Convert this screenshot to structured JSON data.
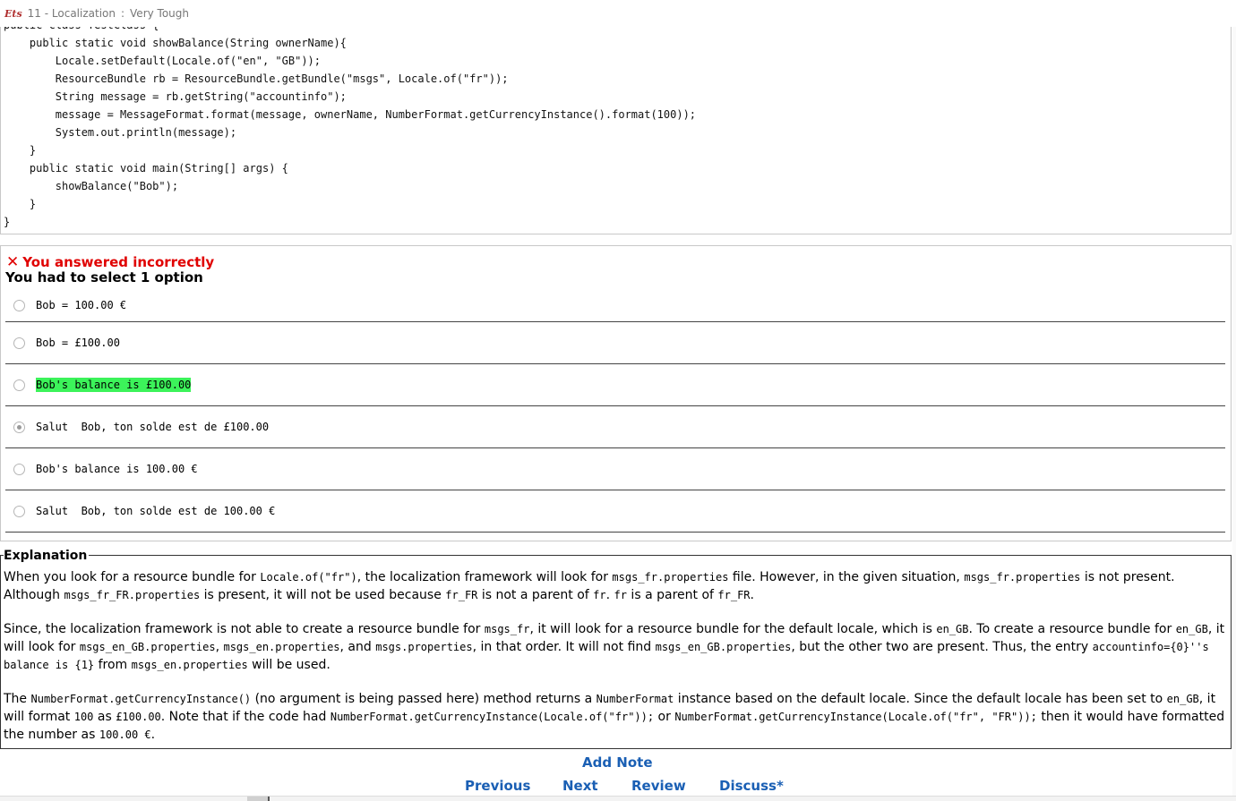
{
  "titlebar": {
    "logo": "Ets",
    "chapter": "11 - Localization",
    "separator": ":",
    "difficulty": "Very Tough"
  },
  "code_lines": [
    "public class TestClass {",
    "    public static void showBalance(String ownerName){",
    "        Locale.setDefault(Locale.of(\"en\", \"GB\"));",
    "        ResourceBundle rb = ResourceBundle.getBundle(\"msgs\", Locale.of(\"fr\"));",
    "        String message = rb.getString(\"accountinfo\");",
    "        message = MessageFormat.format(message, ownerName, NumberFormat.getCurrencyInstance().format(100));",
    "        System.out.println(message);",
    "    }",
    "    public static void main(String[] args) {",
    "        showBalance(\"Bob\");",
    "    }",
    "}"
  ],
  "result": {
    "icon": "✕",
    "text": "You answered incorrectly",
    "instruction": "You had to select 1 option"
  },
  "options": [
    {
      "text": "Bob = 100.00 €",
      "selected": false,
      "correct": false
    },
    {
      "text": "Bob = £100.00",
      "selected": false,
      "correct": false
    },
    {
      "text": "Bob's balance is £100.00",
      "selected": false,
      "correct": true
    },
    {
      "text": "Salut  Bob, ton solde est de £100.00",
      "selected": true,
      "correct": false
    },
    {
      "text": "Bob's balance is 100.00 €",
      "selected": false,
      "correct": false
    },
    {
      "text": "Salut  Bob, ton solde est de 100.00 €",
      "selected": false,
      "correct": false
    }
  ],
  "explanation": {
    "legend": "Explanation",
    "p1": [
      {
        "t": "When you look for a resource bundle for "
      },
      {
        "c": "Locale.of(\"fr\")"
      },
      {
        "t": ", the localization framework will look for "
      },
      {
        "c": "msgs_fr.properties"
      },
      {
        "t": " file.  However, in the given situation, "
      },
      {
        "c": "msgs_fr.properties"
      },
      {
        "t": " is not present. Although "
      },
      {
        "c": "msgs_fr_FR.properties"
      },
      {
        "t": " is present, it will not be used because "
      },
      {
        "c": "fr_FR"
      },
      {
        "t": " is not a parent of "
      },
      {
        "c": "fr"
      },
      {
        "t": ". "
      },
      {
        "c": "fr"
      },
      {
        "t": " is a parent of "
      },
      {
        "c": "fr_FR"
      },
      {
        "t": "."
      }
    ],
    "p2": [
      {
        "t": "Since, the localization framework is not able to create a resource bundle for "
      },
      {
        "c": "msgs_fr"
      },
      {
        "t": ", it will look for a resource bundle for the default locale, which is "
      },
      {
        "c": "en_GB"
      },
      {
        "t": ". To create a resource bundle for "
      },
      {
        "c": "en_GB"
      },
      {
        "t": ", it will look for "
      },
      {
        "c": "msgs_en_GB.properties"
      },
      {
        "t": ", "
      },
      {
        "c": "msgs_en.properties"
      },
      {
        "t": ", and "
      },
      {
        "c": "msgs.properties"
      },
      {
        "t": ", in that order. It will not find "
      },
      {
        "c": "msgs_en_GB.properties"
      },
      {
        "t": ", but the other two are present. Thus, the entry "
      },
      {
        "c": "accountinfo={0}''s balance is {1}"
      },
      {
        "t": " from "
      },
      {
        "c": "msgs_en.properties"
      },
      {
        "t": " will be used."
      }
    ],
    "p3": [
      {
        "t": "The "
      },
      {
        "c": "NumberFormat.getCurrencyInstance()"
      },
      {
        "t": " (no argument is being passed here) method returns a "
      },
      {
        "c": "NumberFormat"
      },
      {
        "t": " instance based on the default locale. Since the default locale has been set to "
      },
      {
        "c": "en_GB"
      },
      {
        "t": ", it will format "
      },
      {
        "c": "100"
      },
      {
        "t": " as  "
      },
      {
        "c": "£100.00"
      },
      {
        "t": ". Note that if the code had "
      },
      {
        "c": "NumberFormat.getCurrencyInstance(Locale.of(\"fr\"));"
      },
      {
        "t": " or "
      },
      {
        "c": "NumberFormat.getCurrencyInstance(Locale.of(\"fr\", \"FR\"));"
      },
      {
        "t": " then it would have formatted the number as "
      },
      {
        "c": "100.00 €"
      },
      {
        "t": "."
      }
    ]
  },
  "links": {
    "add_note": "Add Note",
    "previous": "Previous",
    "next": "Next",
    "review": "Review",
    "discuss": "Discuss*"
  },
  "colors": {
    "error": "#e00000",
    "correct_highlight": "#3cf35a",
    "link": "#1a5fb4"
  }
}
